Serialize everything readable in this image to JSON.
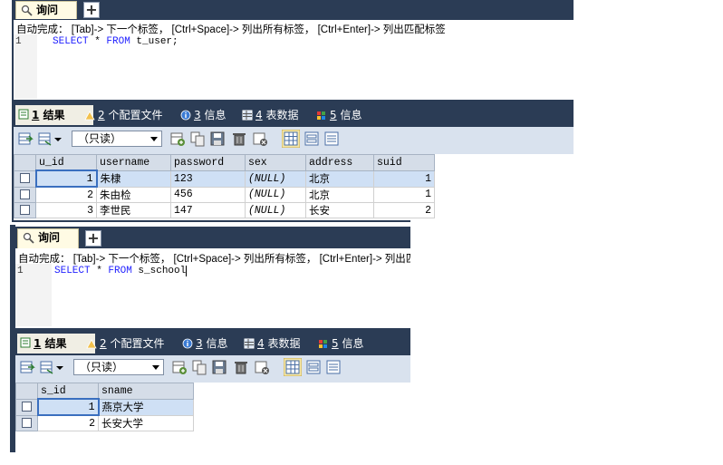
{
  "colors": {
    "tabstrip": "#2b3c55",
    "selected_row": "#cfe0f5",
    "keyword": "#2222ff"
  },
  "panel1": {
    "query_tab": "询问",
    "add_tab": "+",
    "hint": "自动完成： [Tab]-> 下一个标签， [Ctrl+Space]-> 列出所有标签， [Ctrl+Enter]-> 列出匹配标签",
    "line_no": "1",
    "sql_kw1": "SELECT",
    "sql_star": " * ",
    "sql_kw2": "FROM",
    "sql_table": " t_user;",
    "result_tabs": [
      {
        "num": "1",
        "label": "结果",
        "icon": "result-icon"
      },
      {
        "num": "2",
        "label": "个配置文件",
        "icon": "profile-icon"
      },
      {
        "num": "3",
        "label": "信息",
        "icon": "info-icon"
      },
      {
        "num": "4",
        "label": "表数据",
        "icon": "table-data-icon"
      },
      {
        "num": "5",
        "label": "信息",
        "icon": "info2-icon"
      }
    ],
    "mode_select": "（只读）",
    "columns": [
      "u_id",
      "username",
      "password",
      "sex",
      "address",
      "suid"
    ],
    "rows": [
      [
        "1",
        "朱棣",
        "123",
        "(NULL)",
        "北京",
        "1"
      ],
      [
        "2",
        "朱由检",
        "456",
        "(NULL)",
        "北京",
        "1"
      ],
      [
        "3",
        "李世民",
        "147",
        "(NULL)",
        "长安",
        "2"
      ]
    ]
  },
  "panel2": {
    "query_tab": "询问",
    "add_tab": "+",
    "hint": "自动完成： [Tab]-> 下一个标签， [Ctrl+Space]-> 列出所有标签， [Ctrl+Enter]-> 列出匹配标签",
    "line_no": "1",
    "sql_kw1": "SELECT",
    "sql_star": " * ",
    "sql_kw2": "FROM",
    "sql_table": " s_school",
    "result_tabs": [
      {
        "num": "1",
        "label": "结果",
        "icon": "result-icon"
      },
      {
        "num": "2",
        "label": "个配置文件",
        "icon": "profile-icon"
      },
      {
        "num": "3",
        "label": "信息",
        "icon": "info-icon"
      },
      {
        "num": "4",
        "label": "表数据",
        "icon": "table-data-icon"
      },
      {
        "num": "5",
        "label": "信息",
        "icon": "info2-icon"
      }
    ],
    "mode_select": "（只读）",
    "columns": [
      "s_id",
      "sname"
    ],
    "rows": [
      [
        "1",
        "燕京大学"
      ],
      [
        "2",
        "长安大学"
      ]
    ]
  }
}
